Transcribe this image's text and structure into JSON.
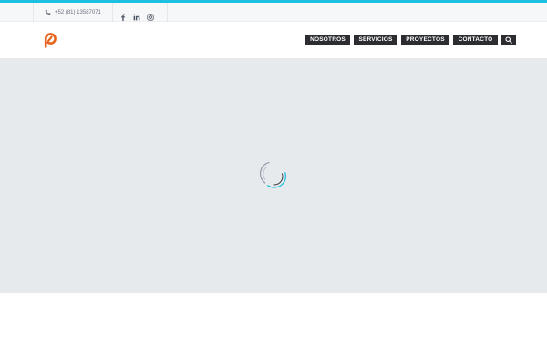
{
  "colors": {
    "accent": "#1ec0e0",
    "nav_bg": "#2b2d31",
    "hero_bg": "#e7eaed",
    "logo": "#e8641c"
  },
  "topbar": {
    "phone": "+52 (81) 13587071",
    "phone_icon": "phone-icon",
    "social": [
      "facebook-icon",
      "linkedin-icon",
      "instagram-icon"
    ]
  },
  "nav": {
    "items": [
      {
        "label": "NOSOTROS"
      },
      {
        "label": "SERVICIOS"
      },
      {
        "label": "PROYECTOS"
      },
      {
        "label": "CONTACTO"
      }
    ],
    "search_icon": "search-icon"
  },
  "hero": {
    "state": "loading",
    "spinner_icon": "loading-spinner-icon"
  }
}
